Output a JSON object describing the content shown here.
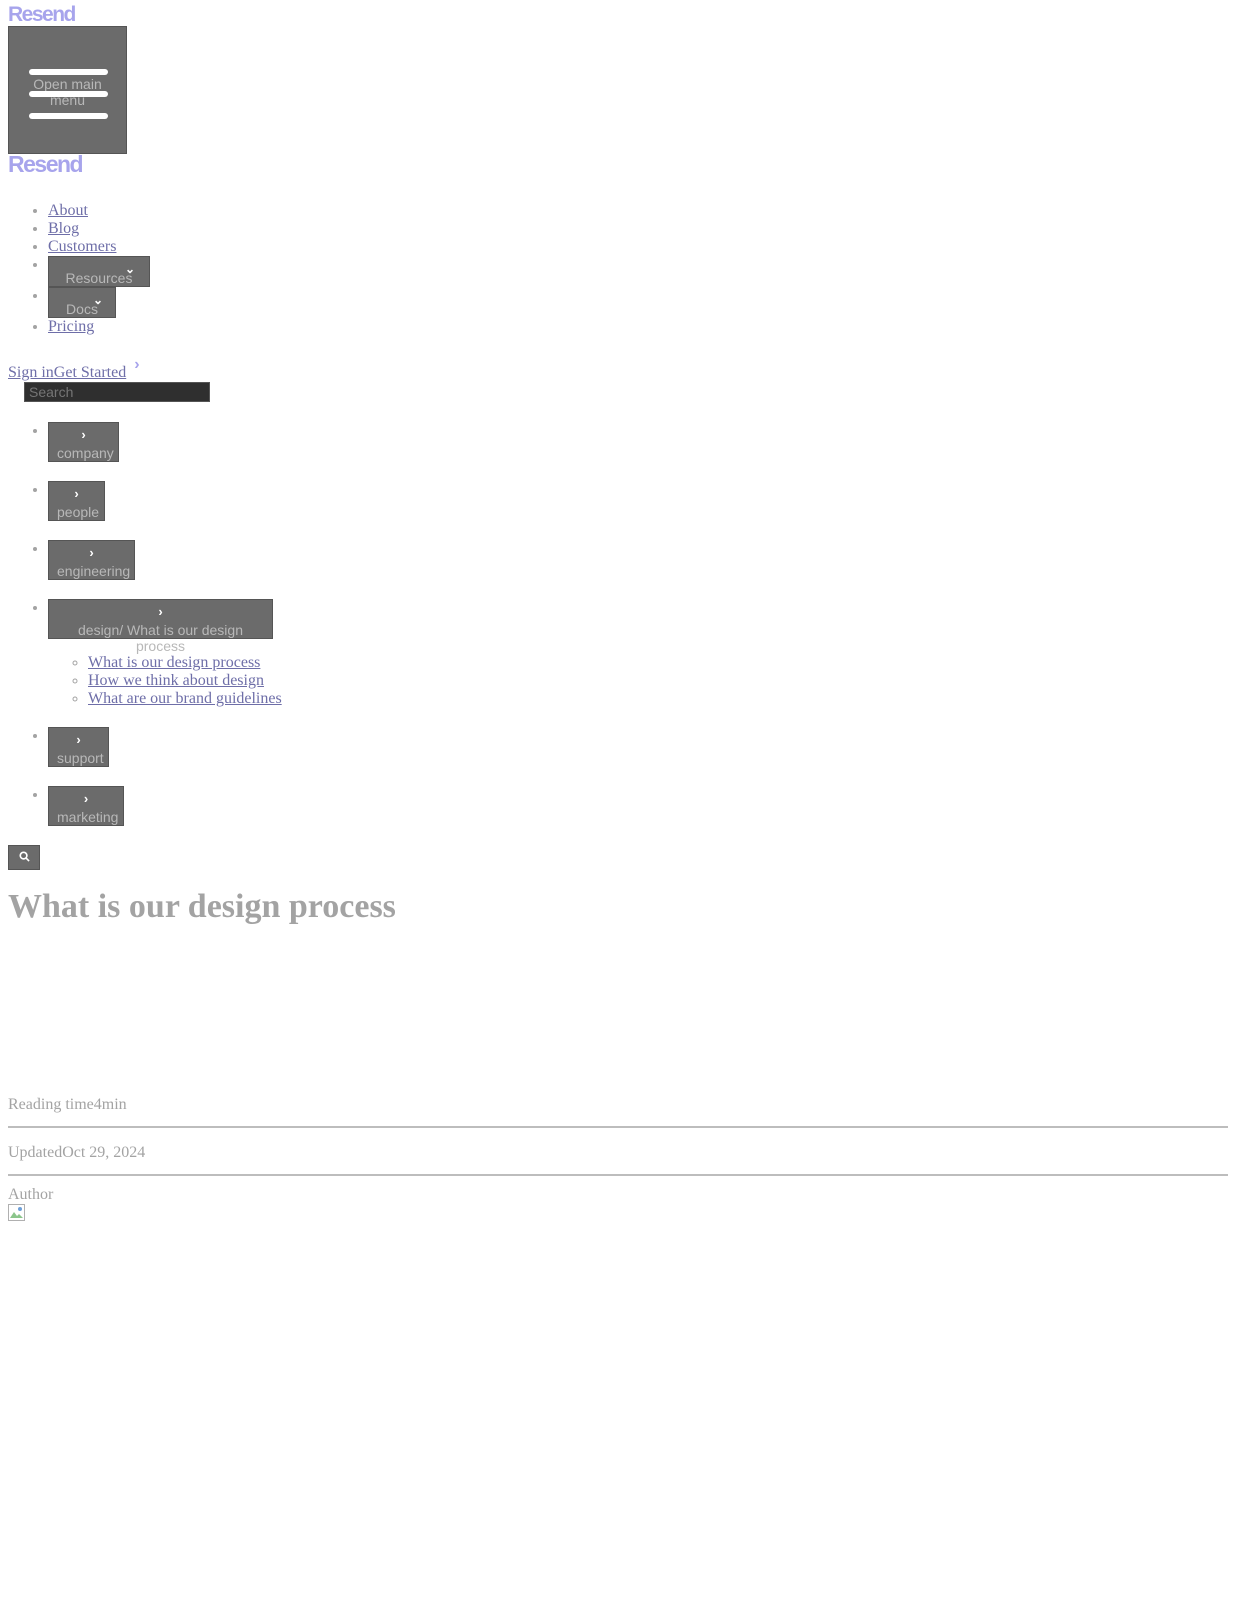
{
  "brand": {
    "logo_text": "Resend",
    "accent": "#a7a4ec"
  },
  "header": {
    "menu_button_label": "Open main menu"
  },
  "nav": {
    "items": [
      {
        "label": "About",
        "type": "link"
      },
      {
        "label": "Blog",
        "type": "link"
      },
      {
        "label": "Customers",
        "type": "link"
      },
      {
        "label": "Resources",
        "type": "dropdown"
      },
      {
        "label": "Docs",
        "type": "dropdown"
      },
      {
        "label": "Pricing",
        "type": "link"
      }
    ],
    "sign_in": "Sign in",
    "get_started": "Get Started"
  },
  "search": {
    "placeholder": "Search"
  },
  "categories": [
    {
      "label": "company"
    },
    {
      "label": "people"
    },
    {
      "label": "engineering"
    },
    {
      "label": "design/ What is our design process",
      "children": [
        "What is our design process",
        "How we think about design",
        "What are our brand guidelines"
      ]
    },
    {
      "label": "support"
    },
    {
      "label": "marketing"
    }
  ],
  "article": {
    "title": "What is our design process",
    "reading_time_label": "Reading time",
    "reading_time_value": "4min",
    "updated_label": "Updated",
    "updated_value": "Oct 29, 2024",
    "author_label": "Author"
  }
}
